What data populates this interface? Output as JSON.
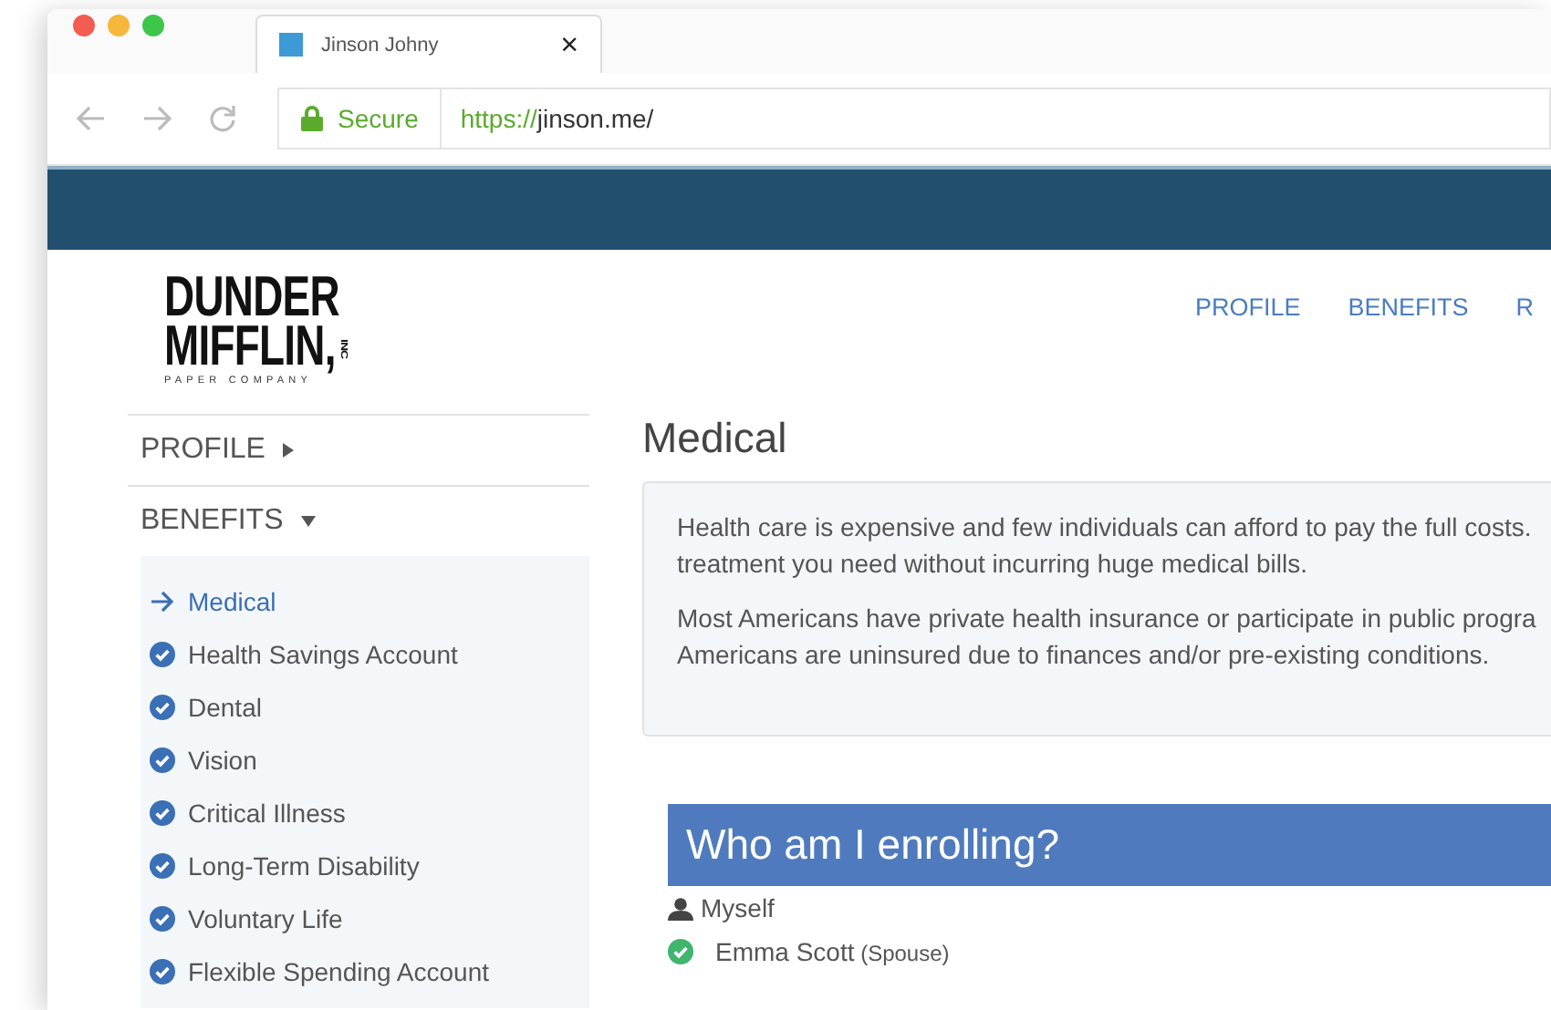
{
  "browser": {
    "tab": {
      "title": "Jinson Johny",
      "close": "×"
    },
    "secure": "Secure",
    "url": {
      "scheme": "https://",
      "address": "jinson.me/"
    }
  },
  "top_nav": [
    {
      "label": "PROFILE"
    },
    {
      "label": "BENEFITS"
    },
    {
      "label": "R"
    }
  ],
  "logo": {
    "line_1": "DUNDER",
    "line_2": "MIFFLIN",
    "comma": ",",
    "suffix": "INC",
    "tagline": "PAPER COMPANY"
  },
  "sidebar": [
    {
      "label": "PROFILE",
      "expanded": false
    },
    {
      "label": "BENEFITS",
      "expanded": true,
      "items": [
        {
          "label": "Medical",
          "selected": true
        },
        {
          "label": "Health Savings Account",
          "selected": false
        },
        {
          "label": "Dental",
          "selected": false
        },
        {
          "label": "Vision",
          "selected": false
        },
        {
          "label": "Critical Illness",
          "selected": false
        },
        {
          "label": "Long-Term Disability",
          "selected": false
        },
        {
          "label": "Voluntary Life",
          "selected": false
        },
        {
          "label": "Flexible Spending Account",
          "selected": false
        }
      ]
    }
  ],
  "main": {
    "heading": "Medical",
    "info": [
      "Health care is expensive and few individuals can afford to pay the full costs.",
      "treatment you need without incurring huge medical bills.",
      "Most Americans have private health insurance or participate in public progra",
      "Americans are uninsured due to finances and/or pre-existing conditions."
    ],
    "enroll": {
      "title": "Who am I enrolling?",
      "members": [
        {
          "kind": "self",
          "name": "Myself"
        },
        {
          "kind": "dependent",
          "name": "Emma Scott",
          "relation": "(Spouse)",
          "checked": true
        }
      ]
    }
  }
}
